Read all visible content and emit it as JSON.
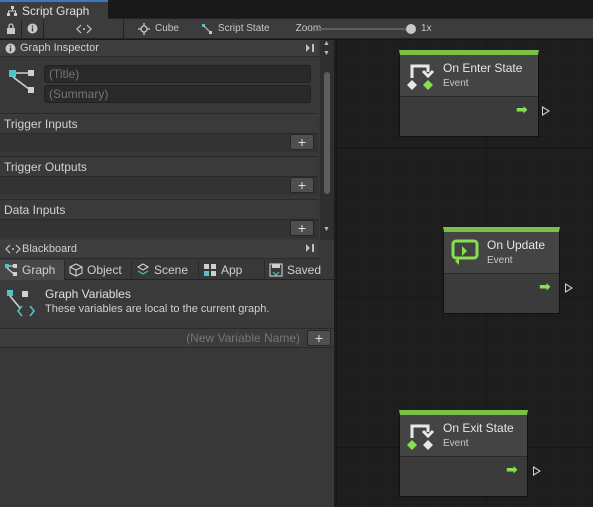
{
  "window": {
    "title": "Script Graph"
  },
  "toolbar": {
    "lock_icon": "lock-icon",
    "info_icon": "info-icon",
    "code_icon": "code-icon",
    "cube_label": "Cube",
    "script_state_label": "Script State",
    "zoom_label": "Zoom",
    "zoom_value": "1x",
    "zoom_level": 1.0
  },
  "inspector": {
    "header": "Graph Inspector",
    "title_placeholder": "(Title)",
    "summary_placeholder": "(Summary)",
    "sections": [
      {
        "label": "Trigger Inputs"
      },
      {
        "label": "Trigger Outputs"
      },
      {
        "label": "Data Inputs"
      }
    ]
  },
  "blackboard": {
    "header": "Blackboard",
    "tabs": [
      {
        "label": "Graph",
        "icon": "graph-icon",
        "active": true
      },
      {
        "label": "Object",
        "icon": "cube-icon",
        "active": false
      },
      {
        "label": "Scene",
        "icon": "scene-icon",
        "active": false
      },
      {
        "label": "App",
        "icon": "app-icon",
        "active": false
      },
      {
        "label": "Saved",
        "icon": "saved-icon",
        "active": false
      }
    ],
    "info_title": "Graph Variables",
    "info_desc": "These variables are local to the current graph.",
    "new_variable_placeholder": "(New Variable Name)"
  },
  "nodes": [
    {
      "title": "On Enter State",
      "subtitle": "Event"
    },
    {
      "title": "On Update",
      "subtitle": "Event"
    },
    {
      "title": "On Exit State",
      "subtitle": "Event"
    }
  ],
  "colors": {
    "accent_green": "#79c149",
    "flow_arrow": "#85e24e",
    "tab_accent": "#3a79bb",
    "icon_teal": "#4fc3c8"
  }
}
